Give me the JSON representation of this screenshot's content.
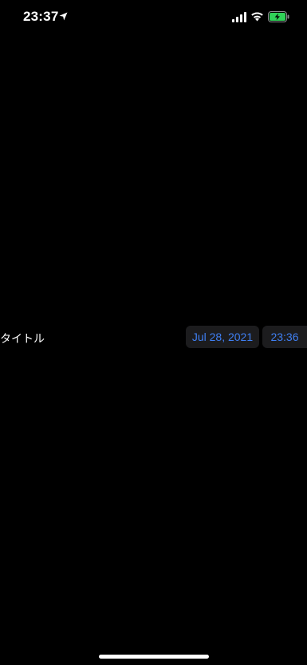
{
  "status_bar": {
    "time": "23:37",
    "location_icon": "location-arrow-icon",
    "signal_icon": "cellular-signal-icon",
    "wifi_icon": "wifi-icon",
    "battery_icon": "battery-charging-icon",
    "battery_color": "#30d158"
  },
  "picker_row": {
    "title": "タイトル",
    "date_value": "Jul 28, 2021",
    "time_value": "23:36"
  },
  "colors": {
    "background": "#000000",
    "accent": "#3f7ff2",
    "button_background": "#1c1c1e"
  }
}
